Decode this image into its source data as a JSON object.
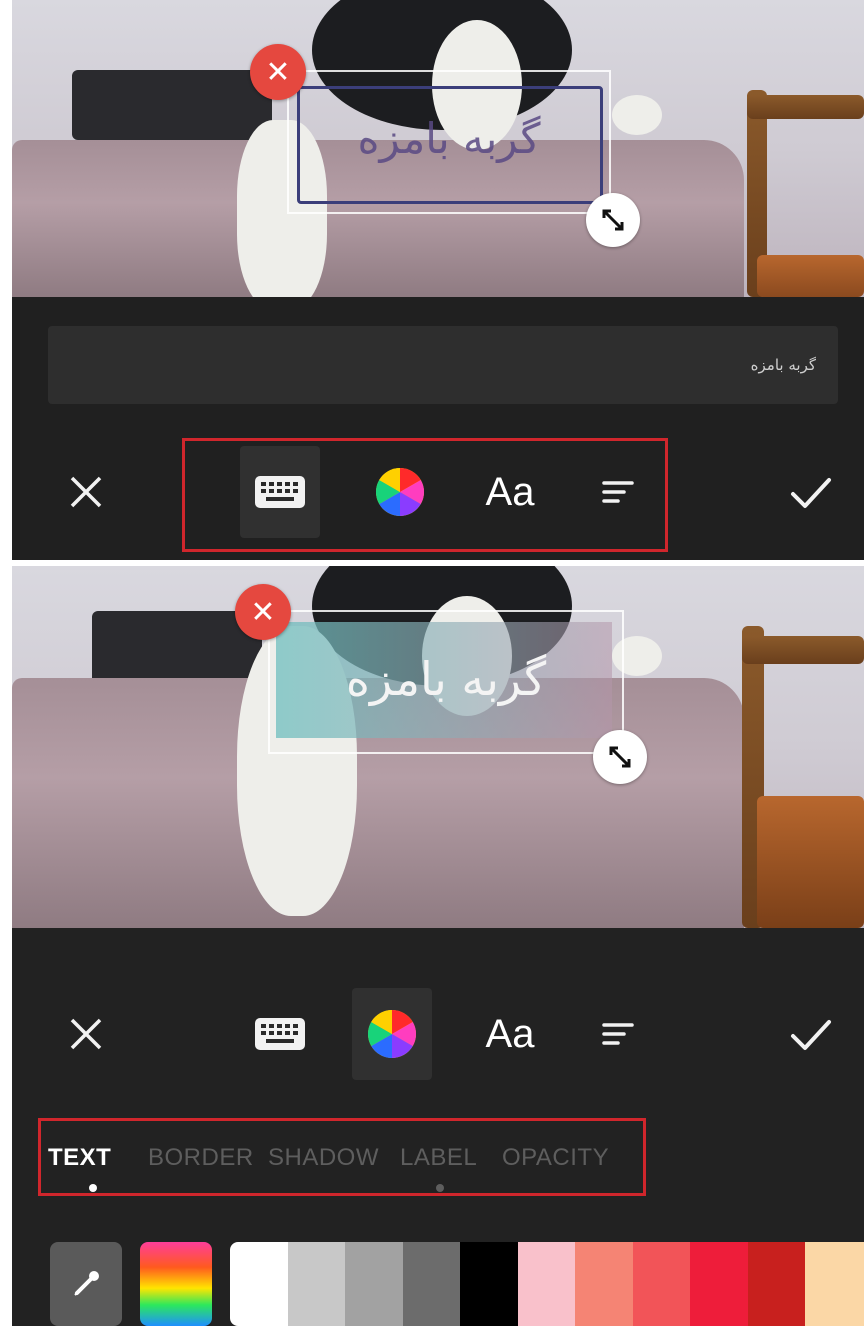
{
  "top": {
    "sticker_text": "گربه بامزه",
    "text_input": {
      "value": "گربه بامزه",
      "placeholder": ""
    },
    "toolbar": {
      "close_symbol": "✕",
      "font_tool_label": "Aa",
      "active_tool": "keyboard"
    }
  },
  "bottom": {
    "sticker_text": "گربه بامزه",
    "toolbar": {
      "close_symbol": "✕",
      "font_tool_label": "Aa",
      "active_tool": "color"
    },
    "tabs": [
      {
        "label": "TEXT",
        "active": true
      },
      {
        "label": "BORDER",
        "active": false
      },
      {
        "label": "SHADOW",
        "active": false
      },
      {
        "label": "LABEL",
        "active": false
      },
      {
        "label": "OPACITY",
        "active": false
      }
    ],
    "palette": {
      "tools": [
        "eyedropper-icon",
        "gradient-picker"
      ],
      "swatches": [
        "#ffffff",
        "#c8c8c8",
        "#a2a2a2",
        "#6c6c6c",
        "#000000",
        "#f9c1cb",
        "#f58474",
        "#f25458",
        "#ee1d3a",
        "#c8201e",
        "#fbd7a6"
      ]
    }
  },
  "colors": {
    "highlight": "#d0262c",
    "delete_button": "#e5483f",
    "toolbar_bg": "#202020"
  }
}
